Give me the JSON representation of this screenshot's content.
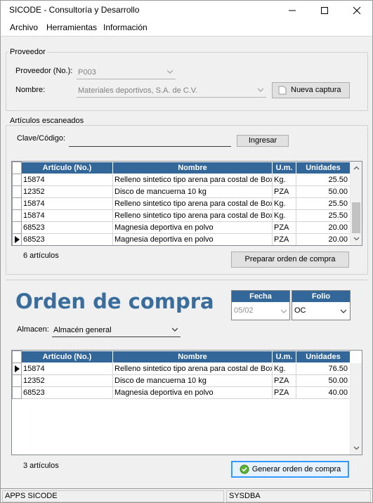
{
  "window": {
    "title": "SICODE - Consultoría y Desarrollo"
  },
  "menu": [
    "Archivo",
    "Herramientas",
    "Información"
  ],
  "proveedor": {
    "legend": "Proveedor",
    "no_label": "Proveedor (No.):",
    "no_value": "P003",
    "nombre_label": "Nombre:",
    "nombre_value": "Materiales deportivos, S.A. de C.V.",
    "nueva_captura": "Nueva captura"
  },
  "escaneados": {
    "legend": "Artículos escaneados",
    "clave_label": "Clave/Código:",
    "clave_value": "",
    "ingresar": "Ingresar",
    "columns": [
      "Artículo (No.)",
      "Nombre",
      "U.m.",
      "Unidades"
    ],
    "rows": [
      {
        "articulo": "15874",
        "nombre": "Relleno sintetico tipo arena para costal de Box",
        "um": "Kg.",
        "unidades": "25.50"
      },
      {
        "articulo": "12352",
        "nombre": "Disco de mancuerna 10 kg",
        "um": "PZA",
        "unidades": "50.00"
      },
      {
        "articulo": "15874",
        "nombre": "Relleno sintetico tipo arena para costal de Box",
        "um": "Kg.",
        "unidades": "25.50"
      },
      {
        "articulo": "15874",
        "nombre": "Relleno sintetico tipo arena para costal de Box",
        "um": "Kg.",
        "unidades": "25.50"
      },
      {
        "articulo": "68523",
        "nombre": "Magnesia deportiva en polvo",
        "um": "PZA",
        "unidades": "20.00"
      },
      {
        "articulo": "68523",
        "nombre": "Magnesia deportiva en polvo",
        "um": "PZA",
        "unidades": "20.00"
      }
    ],
    "current_row": 5,
    "count": "6 artículos",
    "preparar": "Preparar orden de compra"
  },
  "orden": {
    "title": "Orden de compra",
    "fecha_header": "Fecha",
    "fecha_value": "05/02",
    "folio_header": "Folio",
    "folio_value": "OC",
    "almacen_label": "Almacen:",
    "almacen_value": "Almacén general",
    "columns": [
      "Artículo (No.)",
      "Nombre",
      "U.m.",
      "Unidades"
    ],
    "rows": [
      {
        "articulo": "15874",
        "nombre": "Relleno sintetico tipo arena para costal de Box",
        "um": "Kg.",
        "unidades": "76.50"
      },
      {
        "articulo": "12352",
        "nombre": "Disco de mancuerna 10 kg",
        "um": "PZA",
        "unidades": "50.00"
      },
      {
        "articulo": "68523",
        "nombre": "Magnesia deportiva en polvo",
        "um": "PZA",
        "unidades": "40.00"
      }
    ],
    "current_row": 0,
    "count": "3 artículos",
    "generar": "Generar orden de compra"
  },
  "status": {
    "left": "APPS SICODE",
    "right": "SYSDBA"
  },
  "colors": {
    "header": "#336699",
    "title_text": "#3a6d9c",
    "generar_border": "#3399ff"
  },
  "icons": {
    "minimize": "minimize-icon",
    "maximize": "maximize-icon",
    "close": "close-icon",
    "nueva_captura": "document-icon",
    "generar": "check-circle-icon"
  }
}
